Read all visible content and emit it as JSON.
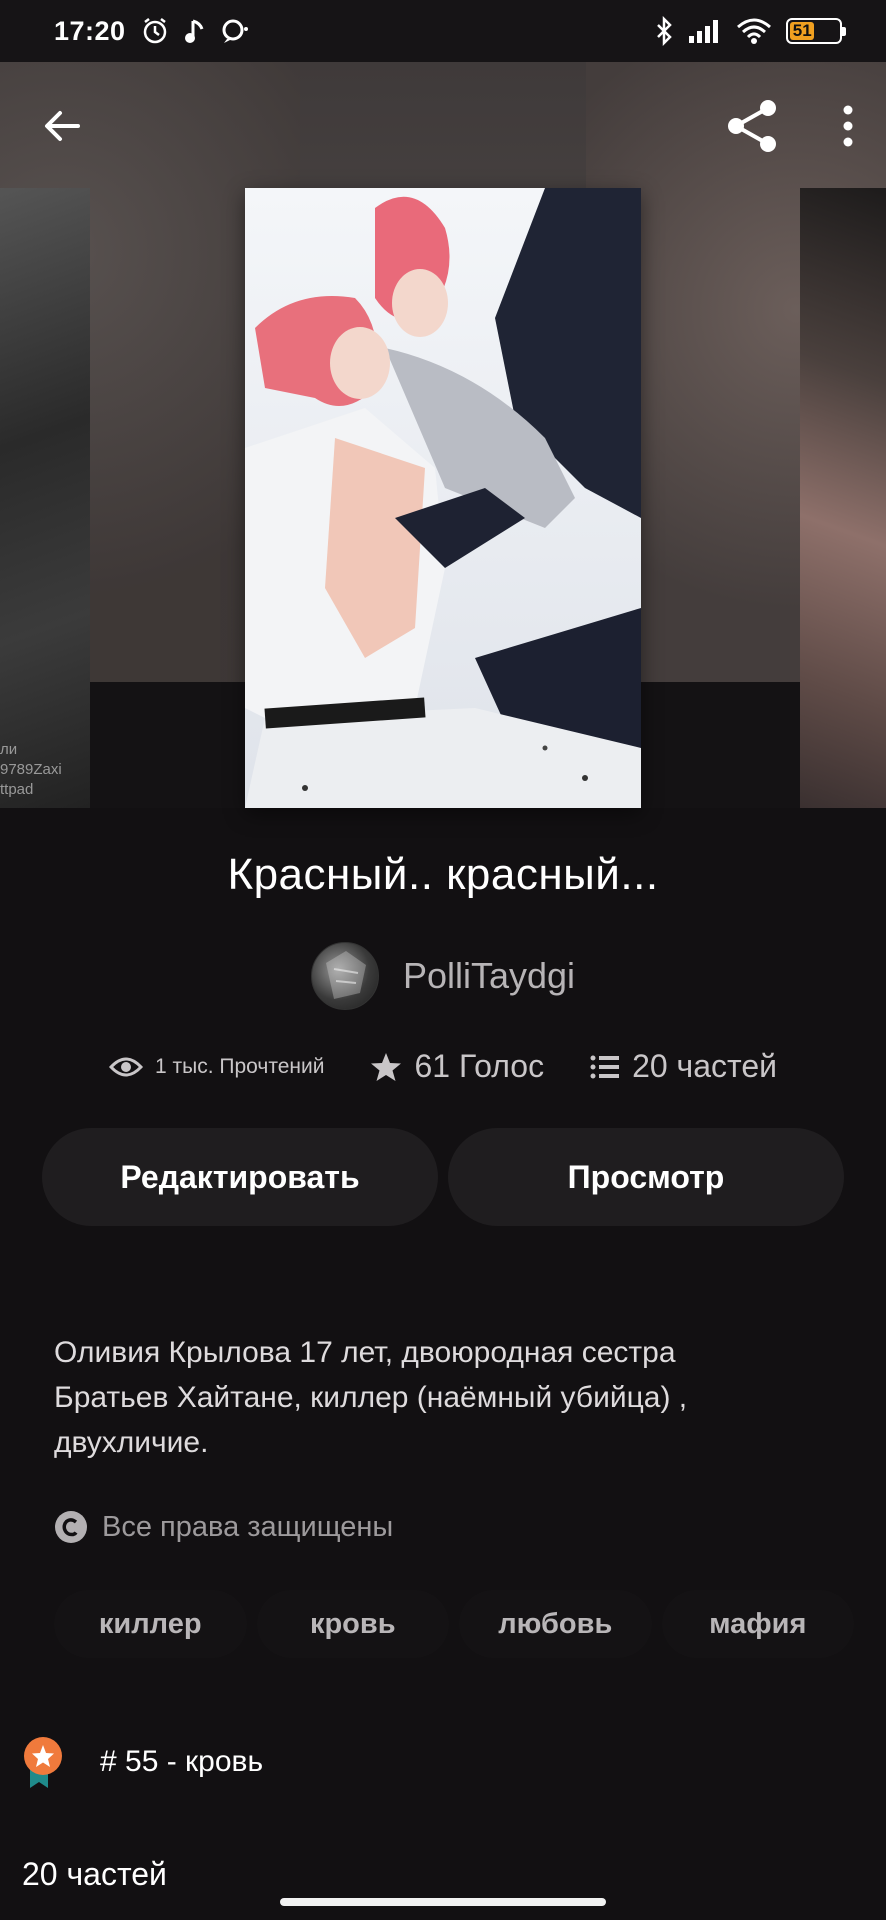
{
  "status_bar": {
    "time": "17:20",
    "battery": "51",
    "battery_level_percent": 51,
    "left_icons": [
      "alarm-icon",
      "music-note-icon",
      "chat-bubble-icon"
    ],
    "right_icons": [
      "bluetooth-icon",
      "signal-icon",
      "wifi-icon",
      "battery-icon"
    ]
  },
  "top_bar": {
    "back_icon": "arrow-left-icon",
    "share_icon": "share-icon",
    "menu_icon": "more-vertical-icon"
  },
  "side_cover_watermark": [
    "ли",
    "9789Zaxi",
    "ttpad"
  ],
  "story": {
    "title": "Красный.. красный...",
    "author": "PolliTaydgi",
    "stats": {
      "reads": "1 тыс. Прочтений",
      "votes": "61 Голос",
      "parts": "20 частей"
    },
    "description": "Оливия Крылова 17 лет, двоюродная сестра Братьев Хайтане, киллер (наёмный убийца) , двухличие.",
    "copyright": "Все права защищены",
    "tags": [
      "киллер",
      "кровь",
      "любовь",
      "мафия"
    ],
    "ranking": "# 55 - кровь",
    "parts_heading": "20 частей"
  },
  "buttons": {
    "edit": "Редактировать",
    "preview": "Просмотр"
  },
  "colors": {
    "background": "#121012",
    "button_bg": "#1f1d1f",
    "badge_orange": "#f07a3c",
    "badge_teal": "#1f8a8a",
    "battery": "#f0a020"
  }
}
